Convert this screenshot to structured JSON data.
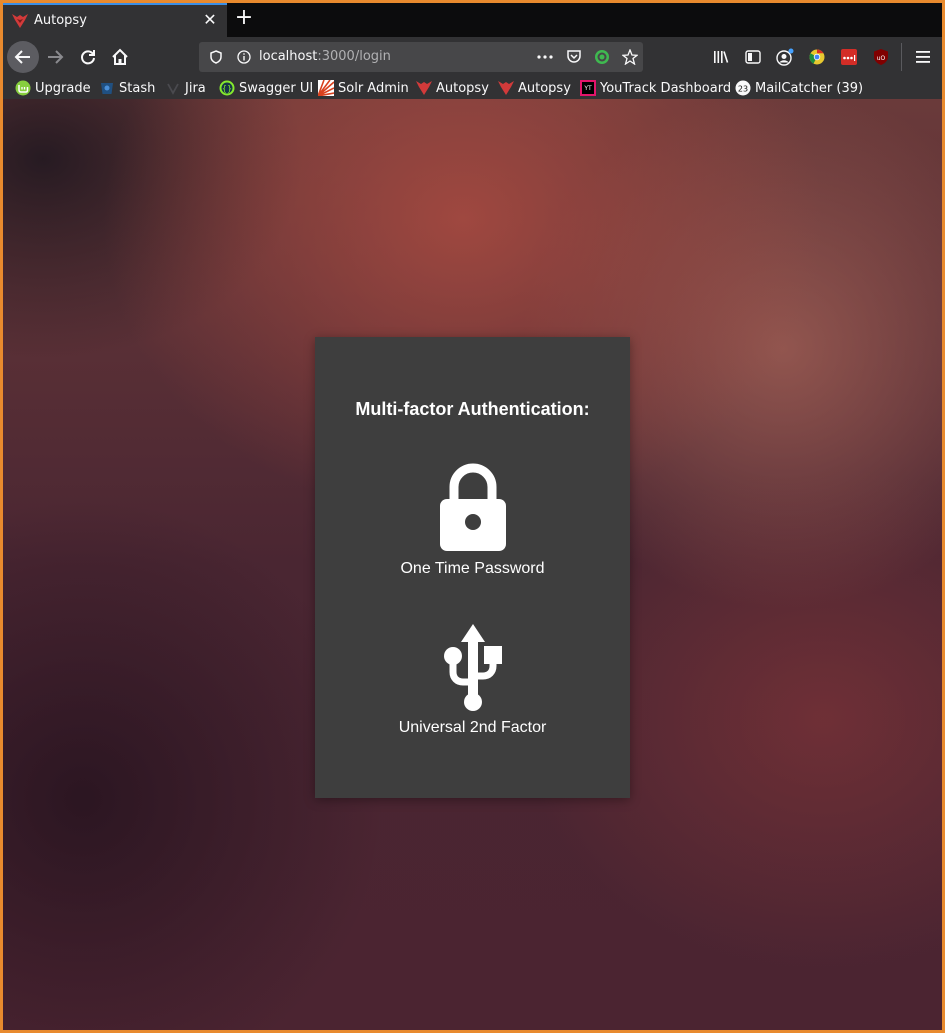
{
  "tab": {
    "title": "Autopsy",
    "close": "✕",
    "new": "+"
  },
  "url": {
    "host": "localhost",
    "rest": ":3000/login"
  },
  "bookmarks": [
    {
      "label": "Upgrade",
      "icon": "linux-mint-icon"
    },
    {
      "label": "Stash",
      "icon": "stash-icon"
    },
    {
      "label": "Jira",
      "icon": "jira-icon"
    },
    {
      "label": "Swagger UI",
      "icon": "swagger-icon"
    },
    {
      "label": "Solr Admin",
      "icon": "solr-icon"
    },
    {
      "label": "Autopsy",
      "icon": "autopsy-icon"
    },
    {
      "label": "Autopsy",
      "icon": "autopsy-icon"
    },
    {
      "label": "YouTrack Dashboard",
      "icon": "youtrack-icon"
    },
    {
      "label": "MailCatcher (39)",
      "icon": "mailcatcher-icon"
    }
  ],
  "card": {
    "title": "Multi-factor Authentication:",
    "options": [
      {
        "label": "One Time Password",
        "icon": "lock-icon"
      },
      {
        "label": "Universal 2nd Factor",
        "icon": "usb-icon"
      }
    ]
  },
  "colors": {
    "accent": "#3a8ee6",
    "card": "#3e3e3e",
    "toolbar": "#323234",
    "frame": "#e88a2e"
  }
}
